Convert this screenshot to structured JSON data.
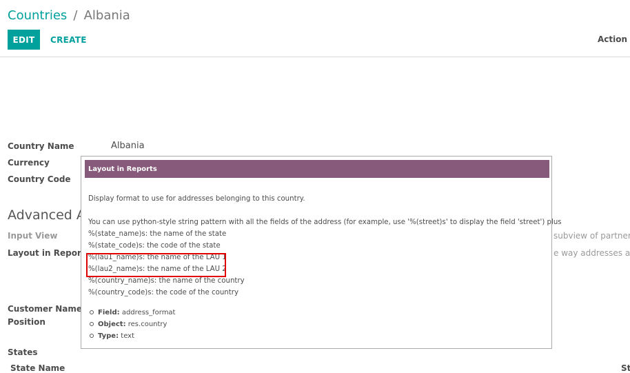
{
  "breadcrumb": {
    "parent": "Countries",
    "separator": "/",
    "current": "Albania"
  },
  "toolbar": {
    "edit_label": "EDIT",
    "create_label": "CREATE",
    "action_label": "Action"
  },
  "form": {
    "country_name_label": "Country Name",
    "country_name_value": "Albania",
    "currency_label": "Currency",
    "country_code_label": "Country Code",
    "advanced_title": "Advanced Ac",
    "input_view_label": "Input View",
    "layout_in_reports_label": "Layout in Reportse",
    "input_view_right_text": "subview of partners",
    "layout_right_text": "e way addresses ar",
    "customer_name_label": "Customer Name",
    "position_label": "Position",
    "states_label": "States",
    "state_name_header": "State Name",
    "right_col_header": "St"
  },
  "tooltip": {
    "title": "Layout in Reports",
    "description": "Display format to use for addresses belonging to this country.",
    "usage_intro": "You can use python-style string pattern with all the fields of the address (for example, use '%(street)s' to display the field 'street') plus",
    "placeholders": [
      "%(state_name)s: the name of the state",
      "%(state_code)s: the code of the state",
      "%(lau1_name)s: the name of the LAU 1",
      "%(lau2_name)s: the name of the LAU 2",
      "%(country_name)s: the name of the country",
      "%(country_code)s: the code of the country"
    ],
    "meta": [
      {
        "key": "Field:",
        "value": "address_format"
      },
      {
        "key": "Object:",
        "value": "res.country"
      },
      {
        "key": "Type:",
        "value": "text"
      }
    ],
    "highlight_color": "#e00000",
    "header_color": "#875A7B"
  },
  "colors": {
    "accent": "#00A09D"
  }
}
